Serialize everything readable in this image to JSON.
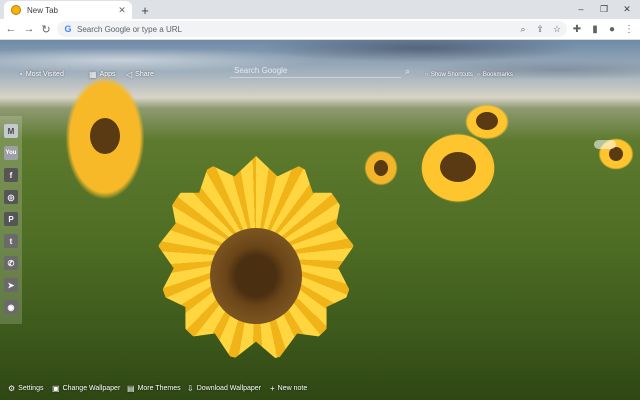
{
  "tab": {
    "title": "New Tab",
    "close_icon": "close-icon",
    "favicon": "sunflower-favicon"
  },
  "window": {
    "new_tab": "+",
    "minimize": "–",
    "restore": "❐",
    "close": "✕"
  },
  "toolbar": {
    "back": "←",
    "forward": "→",
    "reload": "↻",
    "omnibox_placeholder": "Search Google or type a URL",
    "g_letter": "G"
  },
  "page": {
    "top_links": [
      {
        "label": "Most Visited",
        "icon": "clock-icon"
      },
      {
        "label": "Apps",
        "icon": "grid-icon"
      },
      {
        "label": "Share",
        "icon": "share-icon"
      }
    ],
    "search_placeholder": "Search Google",
    "right_links": [
      {
        "label": "Show Shortcuts",
        "icon": "shortcut-icon"
      },
      {
        "label": "Bookmarks",
        "icon": "bookmark-icon"
      }
    ],
    "social_icons": [
      "gmail-icon",
      "youtube-icon",
      "facebook-icon",
      "instagram-icon",
      "pinterest-icon",
      "twitter-icon",
      "whatsapp-icon",
      "telegram-icon",
      "reddit-icon"
    ],
    "bottom_links": [
      {
        "label": "Settings",
        "icon": "gear-icon"
      },
      {
        "label": "Change Wallpaper",
        "icon": "image-icon"
      },
      {
        "label": "More Themes",
        "icon": "themes-icon"
      },
      {
        "label": "Download Wallpaper",
        "icon": "download-icon"
      },
      {
        "label": "New note",
        "icon": "note-icon"
      }
    ]
  }
}
